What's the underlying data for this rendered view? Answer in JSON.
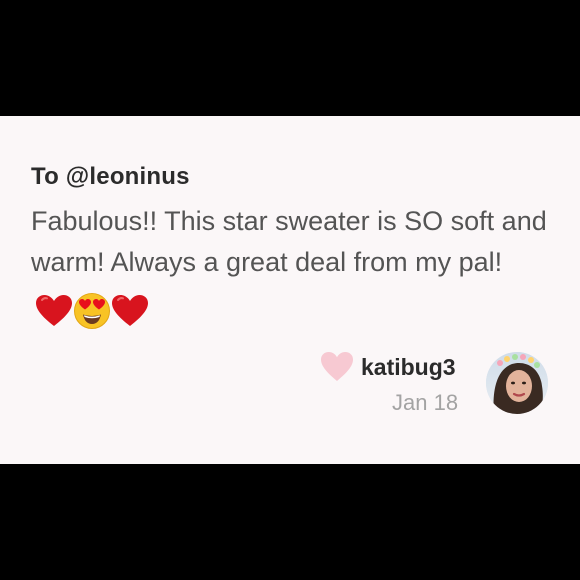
{
  "comment": {
    "recipient": "To @leoninus",
    "message": "Fabulous!! This star sweater is SO soft and warm! Always a great deal from my pal!",
    "emojis": [
      "red-heart-emoji",
      "heart-eyes-emoji",
      "red-heart-emoji"
    ],
    "author": "katibug3",
    "date": "Jan 18",
    "like_icon": "heart-icon",
    "avatar_icon": "user-avatar"
  },
  "colors": {
    "background": "#000000",
    "card": "#fbf7f8",
    "text_dark": "#2b2b2b",
    "text_body": "#545454",
    "text_muted": "#a3a3a3",
    "like_heart": "#f7c9d2",
    "emoji_red": "#d8141e",
    "emoji_yellow": "#f8c325"
  }
}
